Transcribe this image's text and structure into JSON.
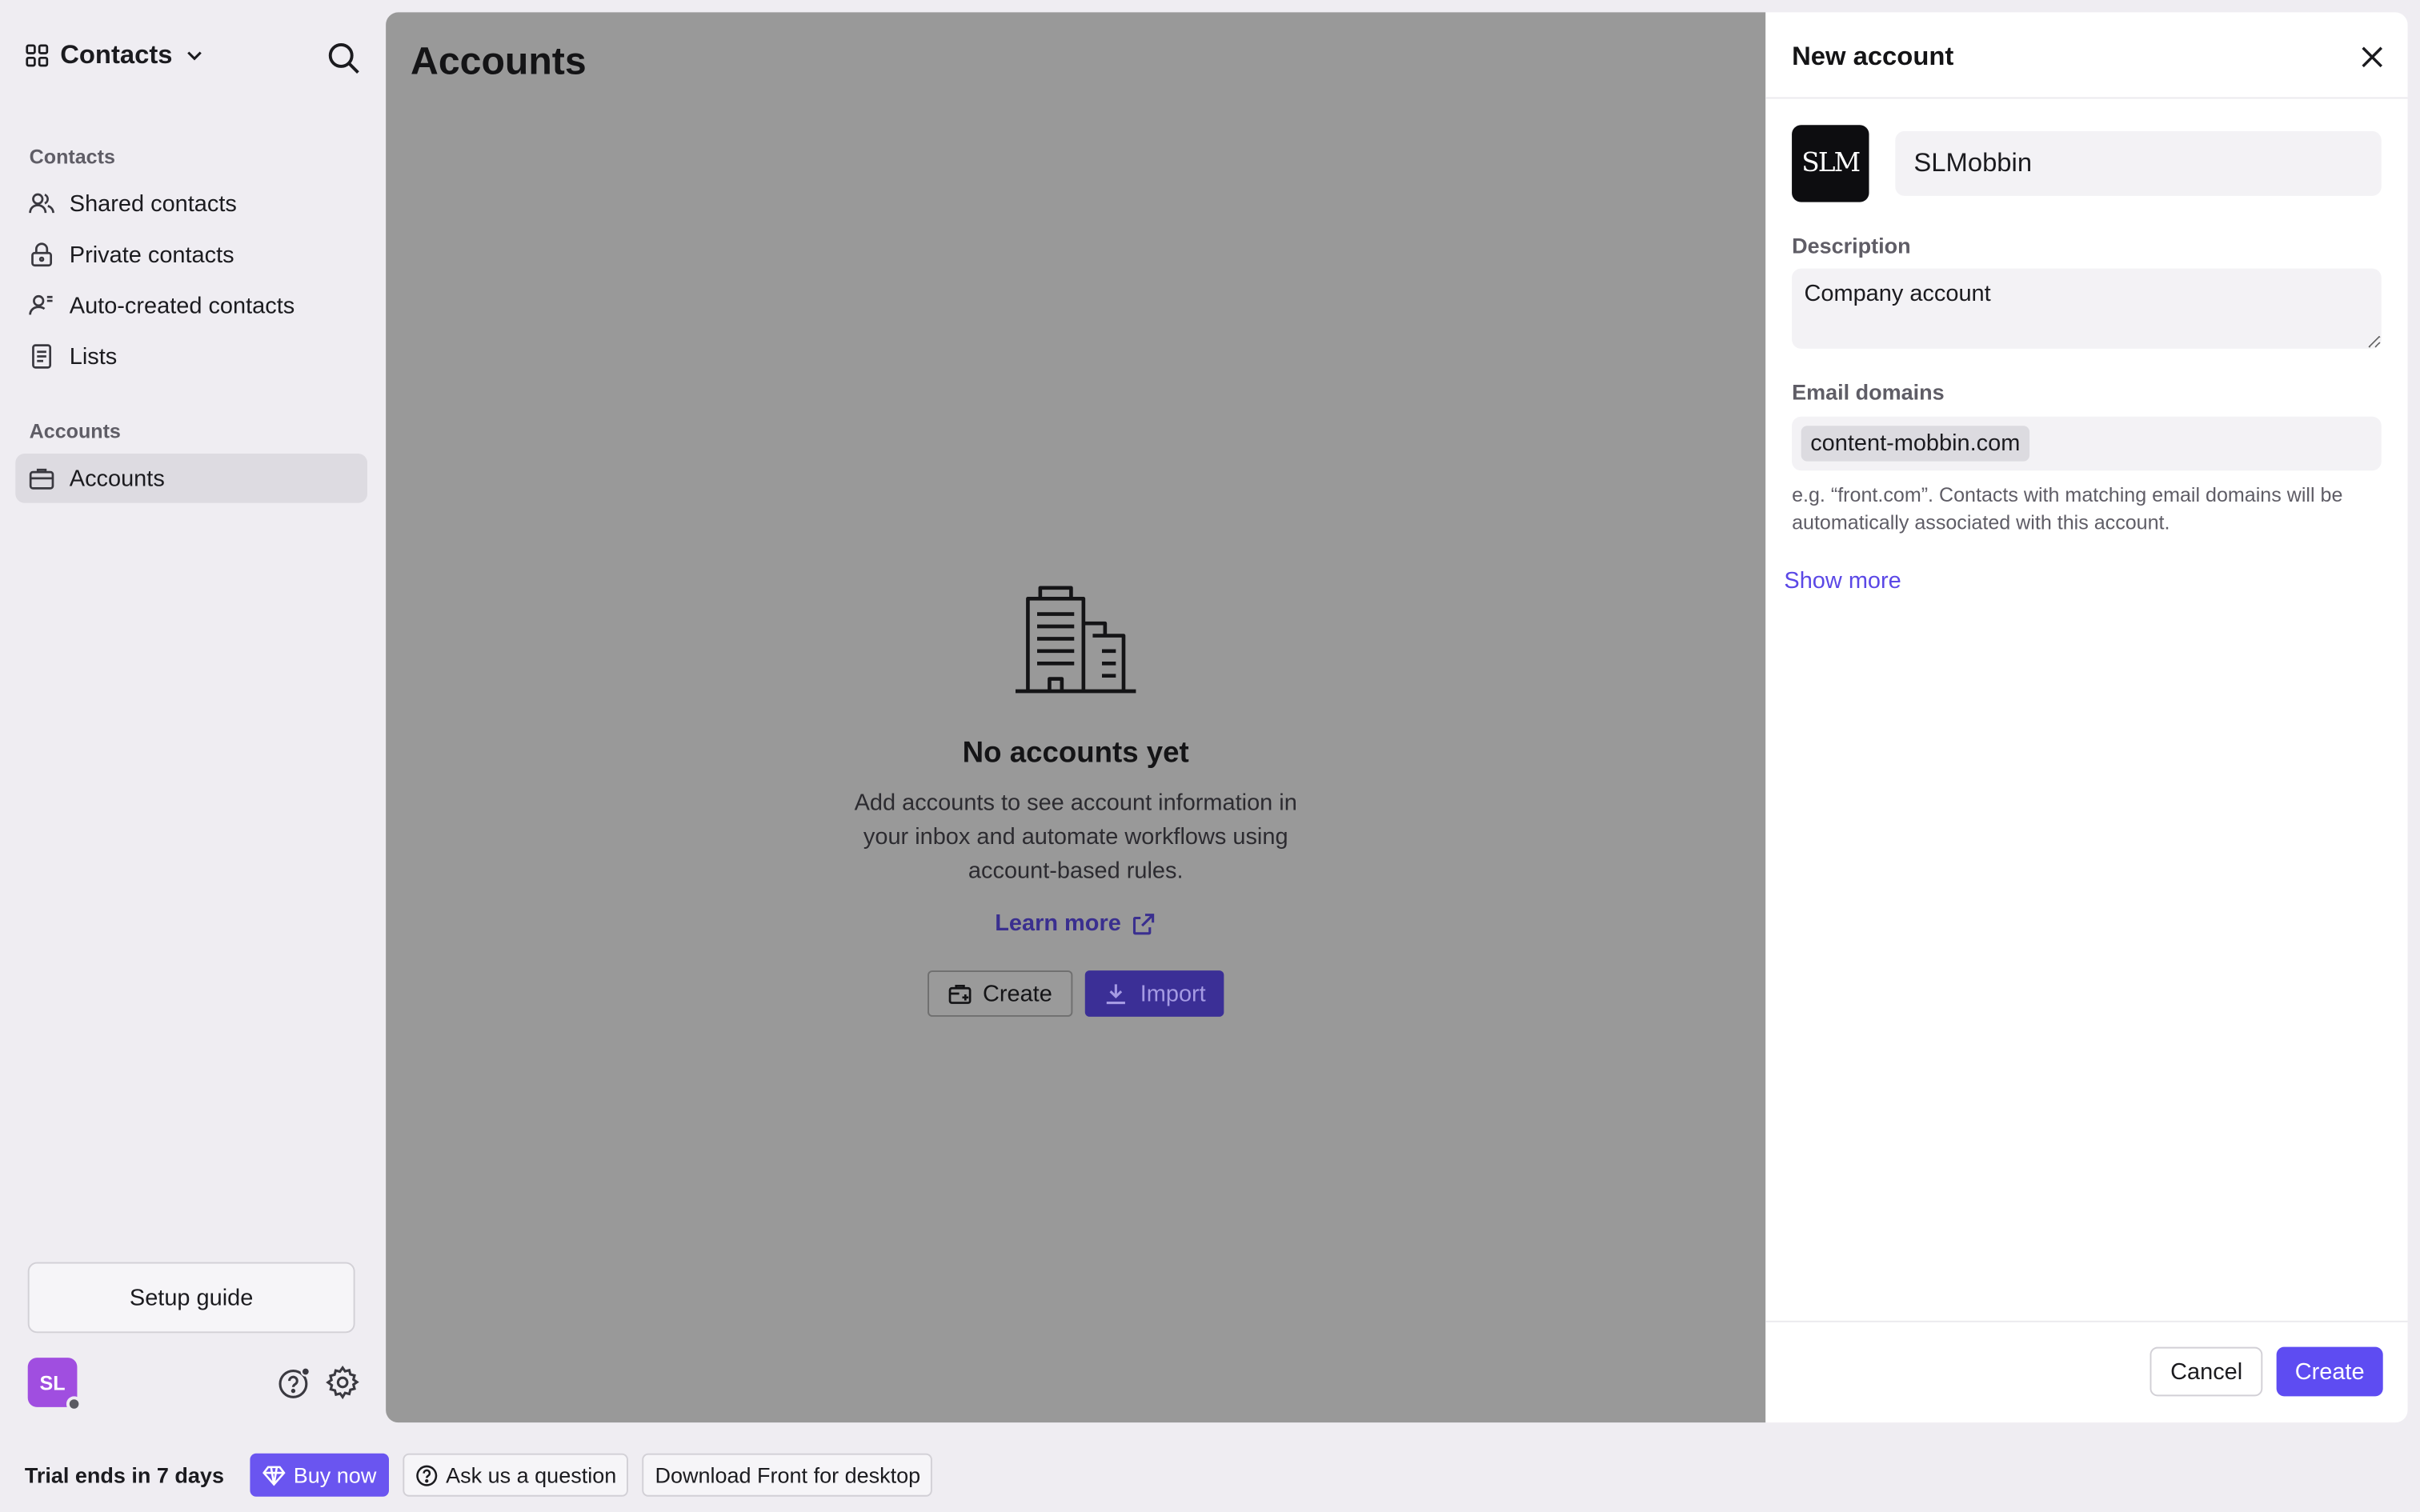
{
  "sidebar": {
    "workspace_title": "Contacts",
    "section_contacts": "Contacts",
    "items": [
      {
        "label": "Shared contacts",
        "icon": "users-icon"
      },
      {
        "label": "Private contacts",
        "icon": "lock-icon"
      },
      {
        "label": "Auto-created contacts",
        "icon": "user-auto-icon"
      },
      {
        "label": "Lists",
        "icon": "list-icon"
      }
    ],
    "section_accounts": "Accounts",
    "accounts_item": {
      "label": "Accounts",
      "icon": "briefcase-icon"
    },
    "setup_guide": "Setup guide",
    "avatar_initials": "SL"
  },
  "main": {
    "title": "Accounts",
    "empty": {
      "title": "No accounts yet",
      "description": "Add accounts to see account information in your inbox and automate workflows using account-based rules.",
      "learn_more": "Learn more",
      "create_label": "Create",
      "import_label": "Import"
    }
  },
  "drawer": {
    "title": "New account",
    "logo_text": "SLM",
    "name_value": "SLMobbin",
    "description_label": "Description",
    "description_value": "Company account",
    "domains_label": "Email domains",
    "domains": [
      "content-mobbin.com"
    ],
    "hint": "e.g. “front.com”. Contacts with matching email domains will be automatically associated with this account.",
    "show_more": "Show more",
    "cancel": "Cancel",
    "create": "Create"
  },
  "bottombar": {
    "trial": "Trial ends in 7 days",
    "buy_now": "Buy now",
    "ask": "Ask us a question",
    "download": "Download Front for desktop"
  },
  "colors": {
    "accent": "#5e4cf2",
    "overlay": "#999999",
    "avatar": "#a04ee0"
  }
}
